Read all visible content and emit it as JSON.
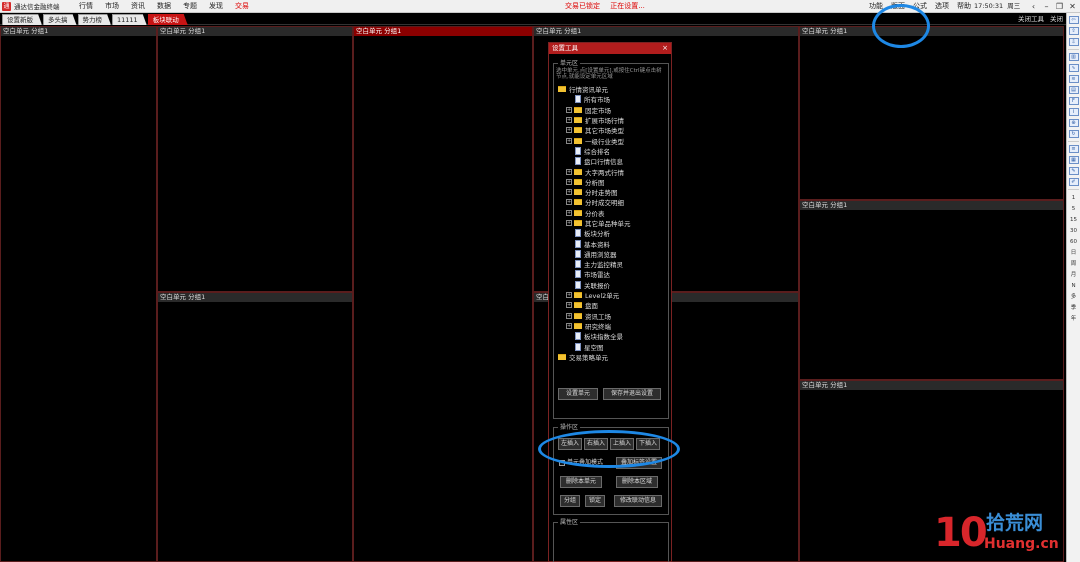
{
  "app": {
    "icon_text": "通",
    "title": "通达信金融终端"
  },
  "menu": [
    "行情",
    "市场",
    "资讯",
    "数据",
    "专题",
    "发现",
    "交易"
  ],
  "status": [
    "交易已锁定",
    "正在设置..."
  ],
  "right_menu": [
    "功能",
    "版面",
    "公式",
    "选项",
    "帮助"
  ],
  "clock": {
    "time": "17:50:31",
    "day": "周三"
  },
  "window_controls": {
    "back": "‹",
    "minimize": "–",
    "restore": "❐",
    "close": "✕"
  },
  "tabs": [
    "设置新版",
    "多头搞",
    "势力榜",
    "11111",
    "板块联动"
  ],
  "active_tab": 4,
  "tab_right": {
    "close_tool": "关闭工具",
    "close": "关闭"
  },
  "cells": {
    "c1": "空白单元 分组1",
    "c2": "空白单元 分组1",
    "c3": "空白单元 分组1",
    "c4": "空白单元 分组1",
    "c5": "空白单元 分组1",
    "c6": "空白单元 分组1",
    "c7": "空白单元 分组1",
    "c8": "空白单元 分组1",
    "c9": "空白单元 分组1"
  },
  "dialog": {
    "title": "设置工具",
    "close": "×",
    "unit_group": "单元区",
    "hint": "选中单元,点[设置单元],或按住Ctrl键点击树节点,就能设定单元区域",
    "tree": [
      {
        "label": "行情资讯单元",
        "type": "folder",
        "level": 0,
        "expand": "none"
      },
      {
        "label": "所有市场",
        "type": "doc",
        "level": 1,
        "expand": "none"
      },
      {
        "label": "固定市场",
        "type": "folder",
        "level": 1,
        "expand": "+"
      },
      {
        "label": "扩展市场行情",
        "type": "folder",
        "level": 1,
        "expand": "+"
      },
      {
        "label": "其它市场类型",
        "type": "folder",
        "level": 1,
        "expand": "+"
      },
      {
        "label": "一级行业类型",
        "type": "folder",
        "level": 1,
        "expand": "+"
      },
      {
        "label": "综合排名",
        "type": "doc",
        "level": 1,
        "expand": "none"
      },
      {
        "label": "盘口行情信息",
        "type": "doc",
        "level": 1,
        "expand": "none"
      },
      {
        "label": "大字两式行情",
        "type": "folder",
        "level": 1,
        "expand": "+"
      },
      {
        "label": "分析图",
        "type": "folder",
        "level": 1,
        "expand": "+"
      },
      {
        "label": "分时走势图",
        "type": "folder",
        "level": 1,
        "expand": "+"
      },
      {
        "label": "分时成交明细",
        "type": "folder",
        "level": 1,
        "expand": "+"
      },
      {
        "label": "分价表",
        "type": "folder",
        "level": 1,
        "expand": "+"
      },
      {
        "label": "其它单品种单元",
        "type": "folder",
        "level": 1,
        "expand": "+"
      },
      {
        "label": "板块分析",
        "type": "doc",
        "level": 1,
        "expand": "none"
      },
      {
        "label": "基本资料",
        "type": "doc",
        "level": 1,
        "expand": "none"
      },
      {
        "label": "通用浏览器",
        "type": "doc",
        "level": 1,
        "expand": "none"
      },
      {
        "label": "主力监控精灵",
        "type": "doc",
        "level": 1,
        "expand": "none"
      },
      {
        "label": "市场雷达",
        "type": "doc",
        "level": 1,
        "expand": "none"
      },
      {
        "label": "关联报价",
        "type": "doc",
        "level": 1,
        "expand": "none"
      },
      {
        "label": "Level2单元",
        "type": "folder",
        "level": 1,
        "expand": "+"
      },
      {
        "label": "盘面",
        "type": "folder",
        "level": 1,
        "expand": "+"
      },
      {
        "label": "资讯工场",
        "type": "folder",
        "level": 1,
        "expand": "+"
      },
      {
        "label": "研究终端",
        "type": "folder",
        "level": 1,
        "expand": "+"
      },
      {
        "label": "板块指数全景",
        "type": "doc",
        "level": 1,
        "expand": "none"
      },
      {
        "label": "星空图",
        "type": "doc",
        "level": 1,
        "expand": "none"
      },
      {
        "label": "交易策略单元",
        "type": "folder",
        "level": 0,
        "expand": "none"
      }
    ],
    "set_unit": "设置单元",
    "save_exit": "保存并退出设置",
    "op_group": "操作区",
    "insert_left": "左插入",
    "insert_right": "右插入",
    "insert_up": "上插入",
    "insert_down": "下插入",
    "overlay_mode": "单元叠加模式",
    "add_overlay_tab": "叠加标签设置",
    "delete_unit": "删除本单元",
    "delete_area": "删除本区域",
    "group": "分组",
    "lock": "锁定",
    "edit_link": "修改联动信息",
    "prop_group": "属性区"
  },
  "right_toolbar": {
    "icons": [
      "back-arrow-icon",
      "up-arrow-icon",
      "down-arrow-icon",
      "kline-chart-icon",
      "minute-chart-icon",
      "compare-icon",
      "trade-icon",
      "f10-icon",
      "info-icon",
      "zoom-icon",
      "refresh-icon",
      "news-icon",
      "layout-icon",
      "draw-icon",
      "pen-icon"
    ],
    "periods": [
      "1",
      "5",
      "15",
      "30",
      "60",
      "日",
      "周",
      "月",
      "N",
      "多",
      "季",
      "年"
    ]
  },
  "watermark": {
    "num": "10",
    "cn": "拾荒网",
    "en": "Huang.cn"
  },
  "colors": {
    "accent_red": "#b11d1d",
    "annotation_blue": "#1e88e5",
    "cell_border": "#5a1d1d"
  }
}
